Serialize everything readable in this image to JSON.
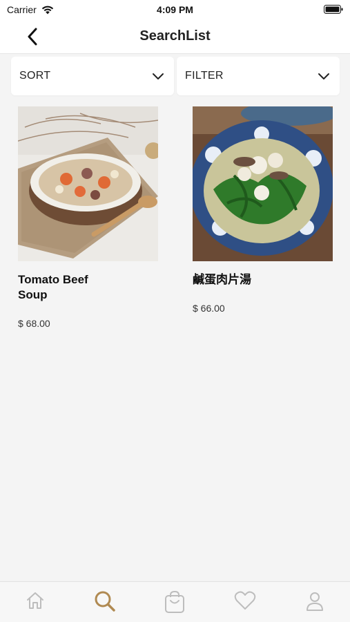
{
  "status_bar": {
    "carrier": "Carrier",
    "time": "4:09 PM"
  },
  "nav": {
    "title": "SearchList",
    "back_icon": "chevron-left-icon"
  },
  "controls": {
    "sort_label": "SORT",
    "filter_label": "FILTER"
  },
  "products": [
    {
      "name": "Tomato Beef Soup",
      "price": "$ 68.00"
    },
    {
      "name": "鹹蛋肉片湯",
      "price": "$ 66.00"
    }
  ],
  "tab_bar": {
    "active_color": "#b08a52",
    "inactive_color": "#bdbdbd",
    "tabs": [
      "home-icon",
      "search-icon",
      "bag-icon",
      "heart-icon",
      "profile-icon"
    ],
    "active_tab": "search-icon"
  }
}
